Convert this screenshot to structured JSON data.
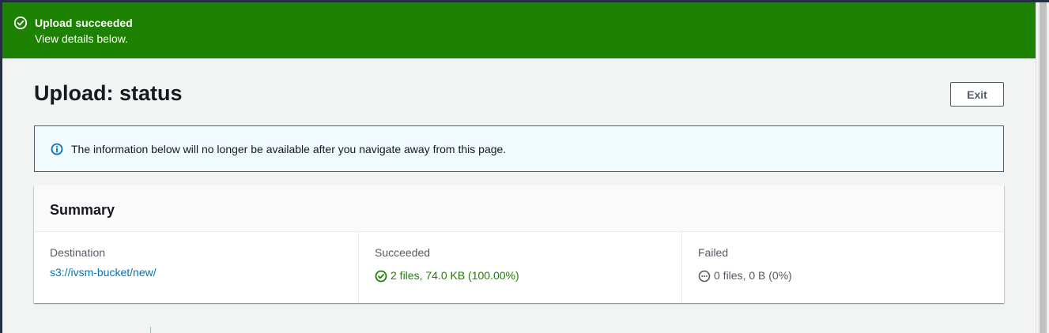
{
  "flash": {
    "title": "Upload succeeded",
    "message": "View details below.",
    "icon": "check-circle-icon",
    "color": "#1d8102"
  },
  "header": {
    "title": "Upload: status",
    "exit_label": "Exit"
  },
  "info": {
    "icon": "info-icon",
    "text": "The information below will no longer be available after you navigate away from this page."
  },
  "summary": {
    "title": "Summary",
    "destination": {
      "label": "Destination",
      "value": "s3://ivsm-bucket/new/"
    },
    "succeeded": {
      "label": "Succeeded",
      "value": "2 files, 74.0 KB (100.00%)",
      "icon": "check-circle-icon",
      "color": "#1d8102"
    },
    "failed": {
      "label": "Failed",
      "value": "0 files, 0 B (0%)",
      "icon": "ellipsis-circle-icon",
      "color": "#545b64"
    }
  }
}
